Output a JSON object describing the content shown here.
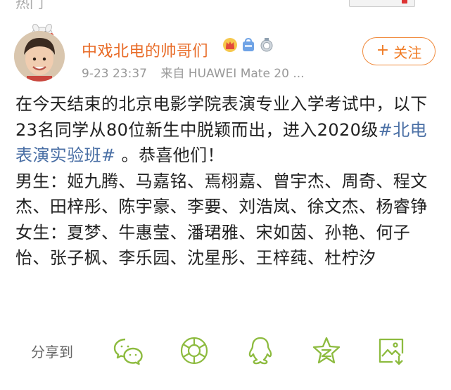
{
  "topbar": {
    "partial_text": "热门"
  },
  "post": {
    "author": "中戏北电的帅哥们",
    "timestamp": "9-23 23:37",
    "source": "来自 HUAWEI Mate 20 ...",
    "follow_label": "关注",
    "follow_icon": "+",
    "badges": [
      "crown-icon",
      "vip-icon",
      "medal-icon"
    ],
    "content": {
      "intro_prefix": "在今天结束的北京电影学院表演专业入学考试中，以下23名同学从80位新生中脱颖而出，进入2020级",
      "hashtag": "#北电表演实验班#",
      "intro_suffix": " 。恭喜他们！",
      "male_label": "男生：",
      "male_names": "姬九腾、马嘉铭、焉栩嘉、曾宇杰、周奇、程文杰、田梓彤、陈宇豪、李要、刘浩岚、徐文杰、杨睿铮",
      "female_label": "女生：",
      "female_names": "夏梦、牛惠莹、潘珺雅、宋如茵、孙艳、何子怡、张子枫、李乐园、沈星彤、王梓莼、杜柠汐"
    }
  },
  "share": {
    "label": "分享到",
    "targets": [
      "wechat-icon",
      "moments-icon",
      "qq-icon",
      "qzone-icon",
      "save-image-icon"
    ]
  },
  "colors": {
    "author": "#e86b27",
    "follow": "#f07a22",
    "hashtag": "#4a6fa5",
    "meta": "#999999",
    "share_icon": "#8dbb3f"
  }
}
